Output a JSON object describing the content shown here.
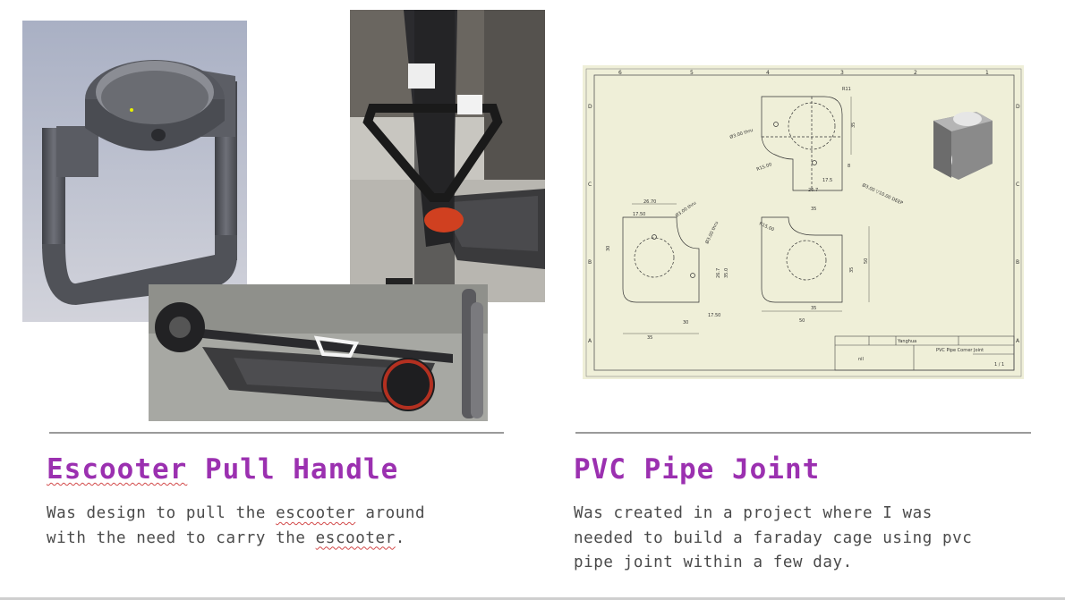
{
  "projects": [
    {
      "title_word1": "Escooter",
      "title_rest": " Pull Handle",
      "desc_line1_pre": "Was design to pull the ",
      "desc_line1_word": "escooter",
      "desc_line1_post": " around",
      "desc_line2_pre": "with the need to carry the ",
      "desc_line2_word": "escooter",
      "desc_line2_post": "."
    },
    {
      "title": "PVC Pipe Joint",
      "desc_lines": [
        "Was created in a project where I was",
        "needed to build a faraday cage using pvc",
        "pipe joint within a few day."
      ]
    }
  ],
  "drawing": {
    "title_block_name": "PVC Pipe Corner Joint",
    "title_block_material": "nil",
    "title_block_sheet": "1 / 1",
    "title_block_designer": "Yanghua",
    "col_numbers": [
      "6",
      "5",
      "4",
      "3",
      "2",
      "1"
    ],
    "row_letters": [
      "D",
      "C",
      "B",
      "A"
    ],
    "dims": {
      "r11": "R11",
      "d1": "Ø3.00 thru",
      "d2": "Ø3.00 ▽10.00 DEEP",
      "r15a": "R15.00",
      "d35a": "35",
      "d8": "8",
      "d175a": "17.5",
      "d267a": "26.7",
      "d2670": "26.70",
      "d1750": "17.50",
      "d30": "30",
      "d35b": "35",
      "d300a": "Ø3.00 thru",
      "d300b": "Ø3.00 thru",
      "d267b": "26.7",
      "d350": "35.0",
      "d1750b": "17.50",
      "d30b": "30",
      "d35c": "35",
      "r1500": "R15.00",
      "d35d": "35",
      "d35e": "35",
      "d50a": "50",
      "d35f": "35",
      "d50b": "50"
    }
  },
  "colors": {
    "title": "#9b30b0",
    "body_text": "#4a4a4a",
    "drawing_bg": "#efefd8",
    "rule": "#9a9a9a"
  }
}
